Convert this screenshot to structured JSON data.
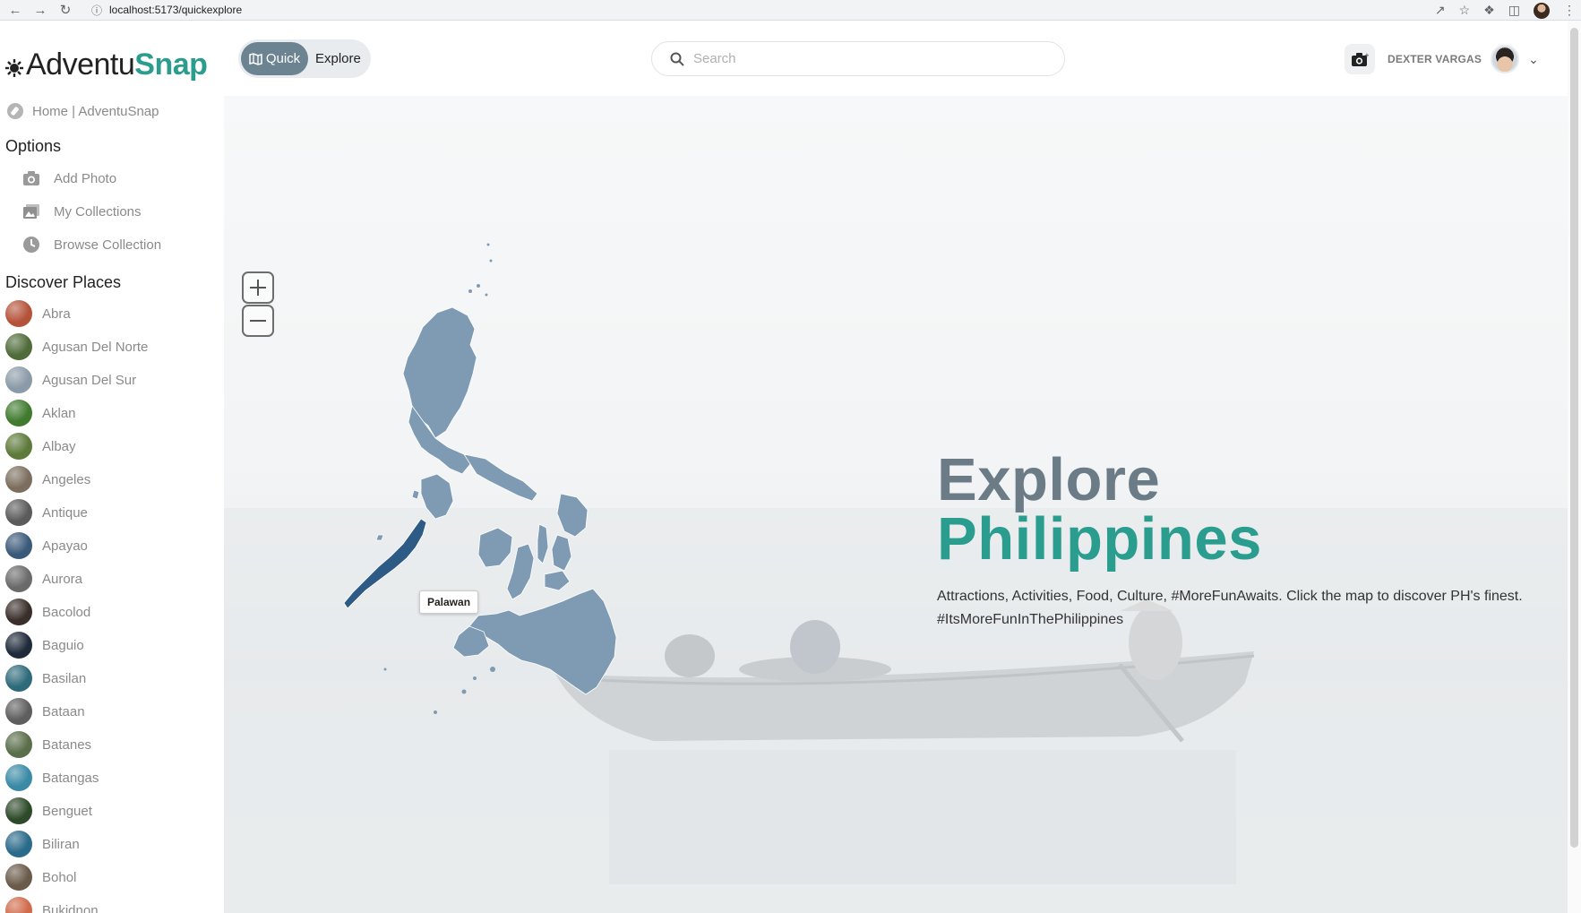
{
  "browser": {
    "url": "localhost:5173/quickexplore"
  },
  "sidebar": {
    "logo_part1": "Adventu",
    "logo_part2": "Snap",
    "home_label": "Home | AdventuSnap",
    "options_title": "Options",
    "options": [
      {
        "label": "Add Photo",
        "icon": "camera-add-icon"
      },
      {
        "label": "My Collections",
        "icon": "gallery-icon"
      },
      {
        "label": "Browse Collection",
        "icon": "clock-history-icon"
      }
    ],
    "places_title": "Discover Places",
    "places": [
      {
        "label": "Abra",
        "color": "#b5533a"
      },
      {
        "label": "Agusan Del Norte",
        "color": "#4f6b3a"
      },
      {
        "label": "Agusan Del Sur",
        "color": "#8a9aa8"
      },
      {
        "label": "Aklan",
        "color": "#3f7a2e"
      },
      {
        "label": "Albay",
        "color": "#5d7a3a"
      },
      {
        "label": "Angeles",
        "color": "#7c6e5e"
      },
      {
        "label": "Antique",
        "color": "#5b5b5b"
      },
      {
        "label": "Apayao",
        "color": "#3b5a7a"
      },
      {
        "label": "Aurora",
        "color": "#6a6a6a"
      },
      {
        "label": "Bacolod",
        "color": "#3a2e2a"
      },
      {
        "label": "Baguio",
        "color": "#1f2a3a"
      },
      {
        "label": "Basilan",
        "color": "#2e6a7a"
      },
      {
        "label": "Bataan",
        "color": "#5e5e5e"
      },
      {
        "label": "Batanes",
        "color": "#5a6e4a"
      },
      {
        "label": "Batangas",
        "color": "#3a8aa6"
      },
      {
        "label": "Benguet",
        "color": "#2e4a2a"
      },
      {
        "label": "Biliran",
        "color": "#2a6a8a"
      },
      {
        "label": "Bohol",
        "color": "#6a5a4a"
      },
      {
        "label": "Bukidnon",
        "color": "#d06a4a"
      }
    ]
  },
  "topbar": {
    "toggle_quick": "Quick",
    "toggle_explore": "Explore",
    "search_placeholder": "Search",
    "user_name": "DEXTER VARGAS"
  },
  "hero": {
    "title_line1": "Explore",
    "title_line2": "Philippines",
    "description": "Attractions, Activities, Food, Culture, #MoreFunAwaits. Click the map to discover PH's finest. #ItsMoreFunInThePhilippines",
    "map_tooltip": "Palawan"
  },
  "colors": {
    "accent": "#2a9d8f",
    "map_fill": "#7f9bb3",
    "map_highlight": "#2e5a86"
  }
}
